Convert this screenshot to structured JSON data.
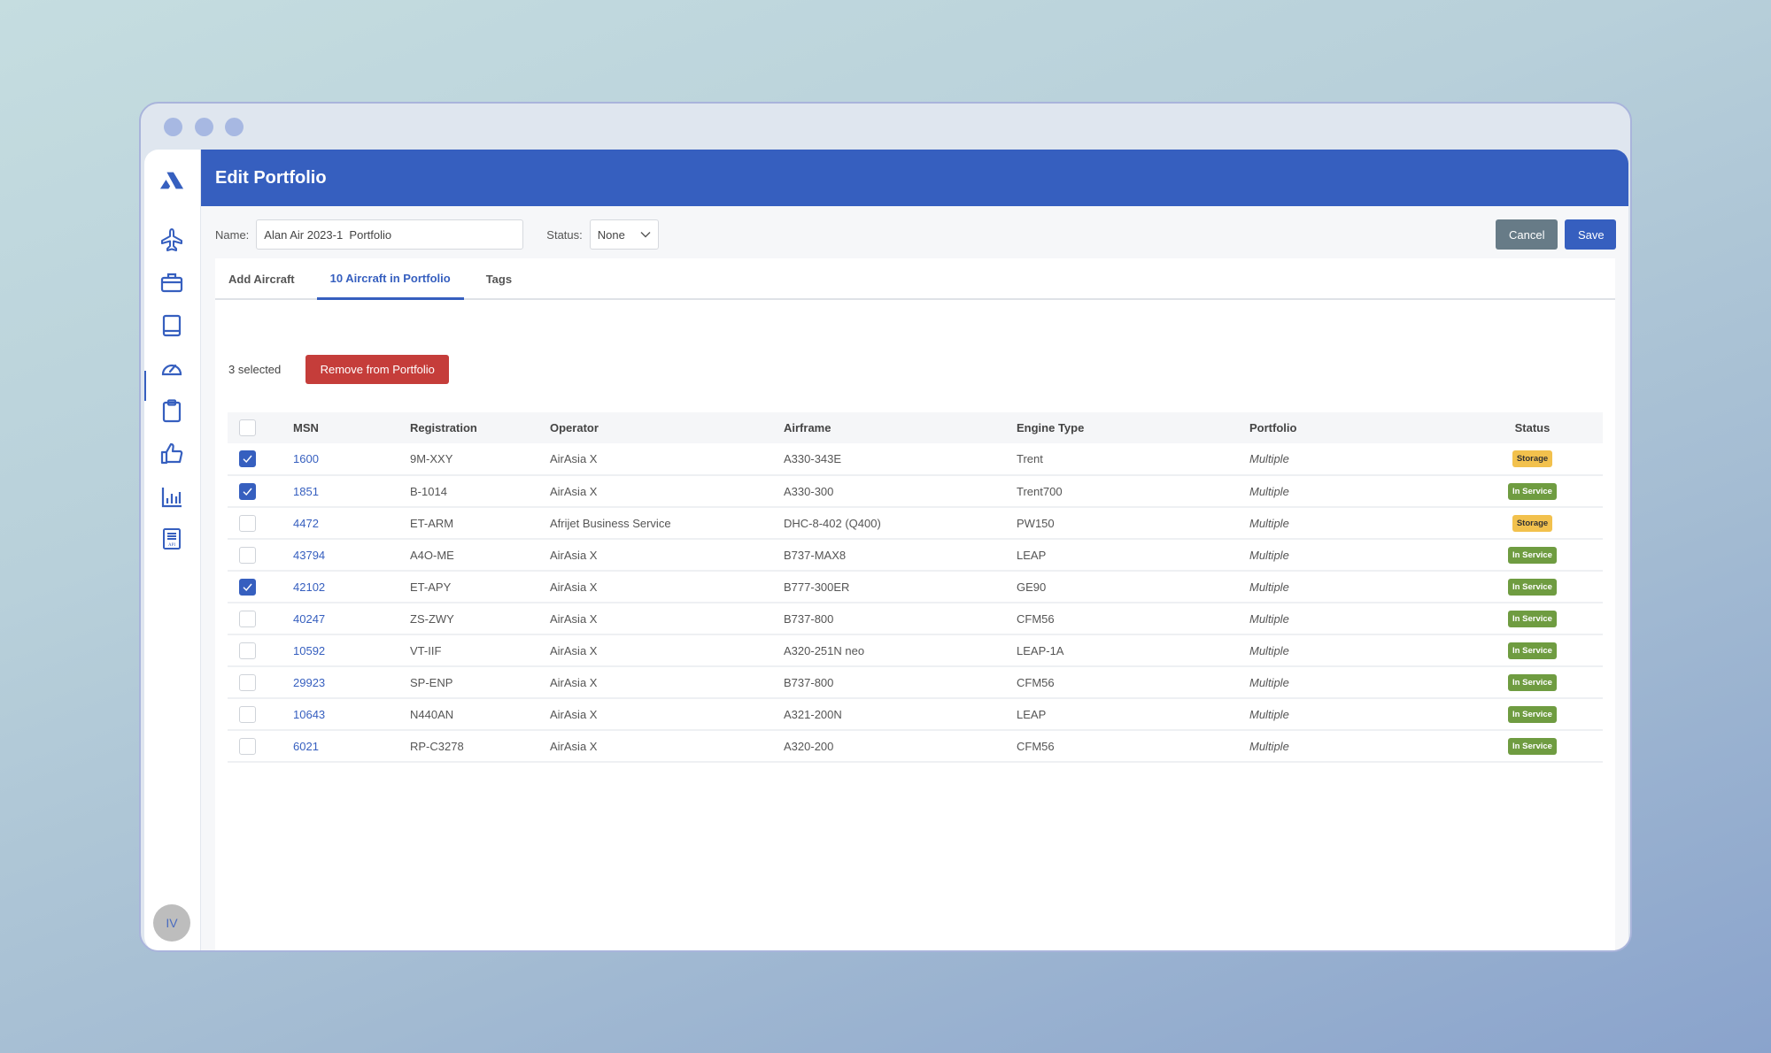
{
  "window": {
    "title": "Edit Portfolio"
  },
  "sidebar": {
    "logo": "brand-logo",
    "items": [
      {
        "name": "aircraft",
        "icon": "airplane-icon"
      },
      {
        "name": "portfolios",
        "icon": "briefcase-icon",
        "active": true
      },
      {
        "name": "library",
        "icon": "book-icon"
      },
      {
        "name": "dashboard",
        "icon": "gauge-icon"
      },
      {
        "name": "reports",
        "icon": "clipboard-icon"
      },
      {
        "name": "approvals",
        "icon": "thumbs-up-icon"
      },
      {
        "name": "analytics",
        "icon": "bar-chart-icon"
      },
      {
        "name": "api",
        "icon": "api-doc-icon",
        "label": "API"
      }
    ],
    "avatar_initials": "IV"
  },
  "form": {
    "name_label": "Name:",
    "name_value": "Alan Air 2023-1  Portfolio",
    "status_label": "Status:",
    "status_value": "None",
    "cancel_label": "Cancel",
    "save_label": "Save"
  },
  "tabs": [
    {
      "label": "Add Aircraft",
      "active": false
    },
    {
      "label": "10 Aircraft in Portfolio",
      "active": true
    },
    {
      "label": "Tags",
      "active": false
    }
  ],
  "selection": {
    "count_text": "3 selected",
    "remove_label": "Remove from Portfolio"
  },
  "table": {
    "columns": [
      "MSN",
      "Registration",
      "Operator",
      "Airframe",
      "Engine Type",
      "Portfolio",
      "Status"
    ],
    "rows": [
      {
        "checked": true,
        "msn": "1600",
        "registration": "9M-XXY",
        "operator": "AirAsia X",
        "airframe": "A330-343E",
        "engine": "Trent",
        "portfolio": "Multiple",
        "status": "Storage"
      },
      {
        "checked": true,
        "msn": "1851",
        "registration": "B-1014",
        "operator": "AirAsia X",
        "airframe": "A330-300",
        "engine": "Trent700",
        "portfolio": "Multiple",
        "status": "In Service"
      },
      {
        "checked": false,
        "msn": "4472",
        "registration": "ET-ARM",
        "operator": "Afrijet Business Service",
        "airframe": "DHC-8-402 (Q400)",
        "engine": "PW150",
        "portfolio": "Multiple",
        "status": "Storage"
      },
      {
        "checked": false,
        "msn": "43794",
        "registration": "A4O-ME",
        "operator": "AirAsia X",
        "airframe": "B737-MAX8",
        "engine": "LEAP",
        "portfolio": "Multiple",
        "status": "In Service"
      },
      {
        "checked": true,
        "msn": "42102",
        "registration": "ET-APY",
        "operator": "AirAsia X",
        "airframe": "B777-300ER",
        "engine": "GE90",
        "portfolio": "Multiple",
        "status": "In Service"
      },
      {
        "checked": false,
        "msn": "40247",
        "registration": "ZS-ZWY",
        "operator": "AirAsia X",
        "airframe": "B737-800",
        "engine": "CFM56",
        "portfolio": "Multiple",
        "status": "In Service"
      },
      {
        "checked": false,
        "msn": "10592",
        "registration": "VT-IIF",
        "operator": "AirAsia X",
        "airframe": "A320-251N neo",
        "engine": "LEAP-1A",
        "portfolio": "Multiple",
        "status": "In Service"
      },
      {
        "checked": false,
        "msn": "29923",
        "registration": "SP-ENP",
        "operator": "AirAsia X",
        "airframe": "B737-800",
        "engine": "CFM56",
        "portfolio": "Multiple",
        "status": "In Service"
      },
      {
        "checked": false,
        "msn": "10643",
        "registration": "N440AN",
        "operator": "AirAsia X",
        "airframe": "A321-200N",
        "engine": "LEAP",
        "portfolio": "Multiple",
        "status": "In Service"
      },
      {
        "checked": false,
        "msn": "6021",
        "registration": "RP-C3278",
        "operator": "AirAsia X",
        "airframe": "A320-200",
        "engine": "CFM56",
        "portfolio": "Multiple",
        "status": "In Service"
      }
    ]
  },
  "colors": {
    "brand": "#365fbf",
    "danger": "#c53d3a",
    "secondary": "#677b87",
    "storage": "#f2c14d",
    "in_service": "#6f9c41"
  }
}
